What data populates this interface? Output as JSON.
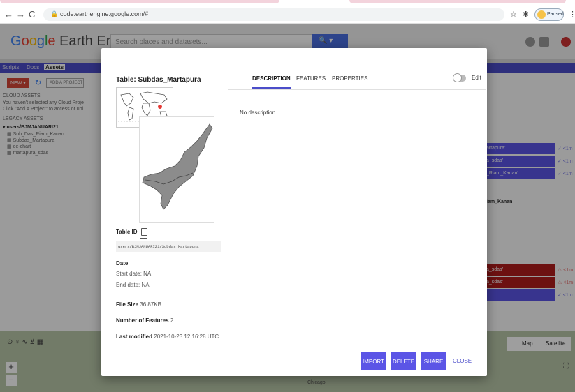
{
  "browser": {
    "url": "code.earthengine.google.com/#",
    "profile_status": "Paused"
  },
  "gee": {
    "logo": {
      "g": "G",
      "o1": "o",
      "o2": "o",
      "g2": "g",
      "l": "l",
      "e": "e",
      "rest": " Earth Engine"
    },
    "search_placeholder": "Search places and datasets...",
    "left_tabs": [
      "Scripts",
      "Docs",
      "Assets"
    ],
    "new_label": "NEW ▾",
    "add_project_label": "ADD A PROJECT",
    "cloud_assets_header": "CLOUD ASSETS",
    "cloud_msg_1": "You haven't selected any Cloud Proje",
    "cloud_msg_2": "Click \"Add A Project\" to access or upl",
    "legacy_header": "LEGACY ASSETS",
    "user_folder": "▾ users/BJMJANUARI21",
    "assets": [
      "Sub_Das_Riam_Kanan",
      "Subdas_Martapura",
      "ee-chart",
      "martapura_sdas"
    ],
    "tasks": [
      {
        "label": "artapura'",
        "color": "#5b55e6",
        "state": "✓ <1m"
      },
      {
        "label": "a_sdas'",
        "color": "#5b55e6",
        "state": "✓ <1m"
      },
      {
        "label": "_Riam_Kanan'",
        "color": "#5b55e6",
        "state": "✓ <1m"
      },
      {
        "label": "a_sdas'",
        "color": "#b01c1c",
        "state": "⚠ <1m"
      },
      {
        "label": "a_sdas'",
        "color": "#b01c1c",
        "state": "⚠ <1m"
      },
      {
        "label": "",
        "color": "#5b55e6",
        "state": "✓ <1m"
      }
    ],
    "task_text": "iam_Kanan",
    "map_type": [
      "Map",
      "Satellite"
    ],
    "map_label": "Chicago"
  },
  "dialog": {
    "title": "Table: Subdas_Martapura",
    "tabs": [
      "DESCRIPTION",
      "FEATURES",
      "PROPERTIES"
    ],
    "edit_label": "Edit",
    "description": "No description.",
    "table_id_label": "Table ID",
    "table_id": "users/BJMJANUARI21/Subdas_Martapura",
    "date_label": "Date",
    "start_date": "Start date: NA",
    "end_date": "End date: NA",
    "file_size_label": "File Size",
    "file_size": "36.87KB",
    "num_features_label": "Number of Features",
    "num_features": "2",
    "last_modified_label": "Last modified",
    "last_modified": "2021-10-23 12:16:28 UTC",
    "buttons": {
      "import": "IMPORT",
      "delete": "DELETE",
      "share": "SHARE",
      "close": "CLOSE"
    }
  }
}
